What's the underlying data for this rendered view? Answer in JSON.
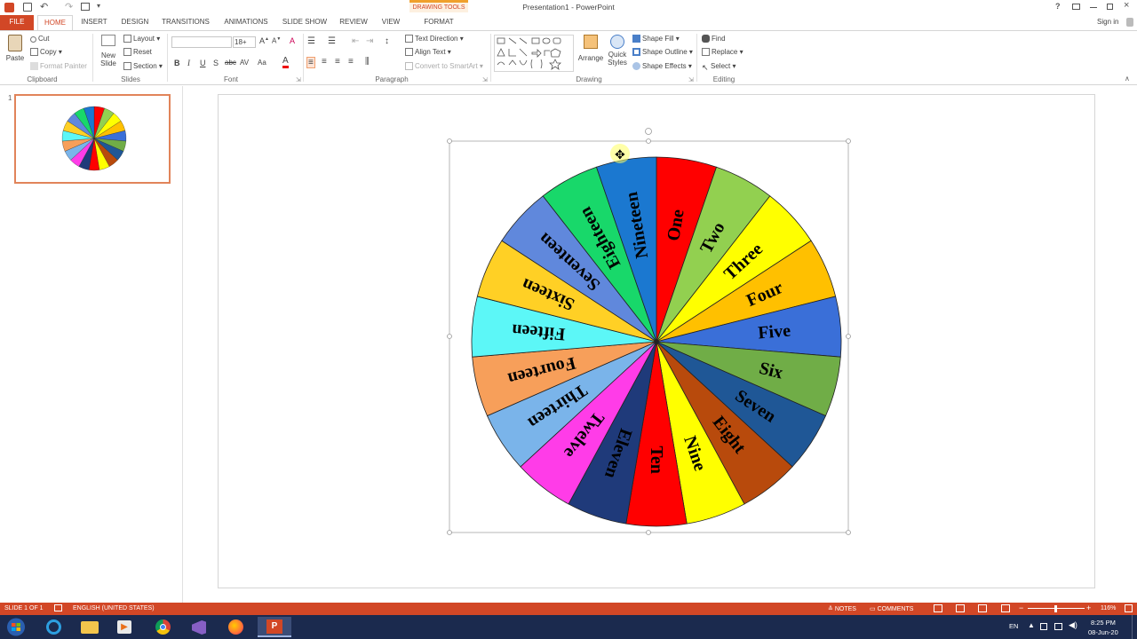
{
  "window": {
    "title": "Presentation1 - PowerPoint",
    "context_tab": "DRAWING TOOLS",
    "sign_in": "Sign in"
  },
  "tabs": [
    "FILE",
    "HOME",
    "INSERT",
    "DESIGN",
    "TRANSITIONS",
    "ANIMATIONS",
    "SLIDE SHOW",
    "REVIEW",
    "VIEW",
    "FORMAT"
  ],
  "ribbon": {
    "clipboard": {
      "label": "Clipboard",
      "paste": "Paste",
      "cut": "Cut",
      "copy": "Copy",
      "format_painter": "Format Painter"
    },
    "slides": {
      "label": "Slides",
      "new_slide_1": "New",
      "new_slide_2": "Slide",
      "layout": "Layout",
      "reset": "Reset",
      "section": "Section"
    },
    "font": {
      "label": "Font",
      "size": "18+",
      "bold": "B",
      "italic": "I",
      "underline": "U",
      "strike": "S",
      "shadow": "abc",
      "spacing": "AV",
      "case": "Aa"
    },
    "paragraph": {
      "label": "Paragraph",
      "text_direction": "Text Direction",
      "align_text": "Align Text",
      "smartart": "Convert to SmartArt"
    },
    "drawing": {
      "label": "Drawing",
      "arrange": "Arrange",
      "quick_styles_1": "Quick",
      "quick_styles_2": "Styles",
      "shape_fill": "Shape Fill",
      "shape_outline": "Shape Outline",
      "shape_effects": "Shape Effects"
    },
    "editing": {
      "label": "Editing",
      "find": "Find",
      "replace": "Replace",
      "select": "Select"
    }
  },
  "thumbnail": {
    "number": "1"
  },
  "wheel": {
    "segments": [
      {
        "label": "One",
        "color": "#ff0000"
      },
      {
        "label": "Two",
        "color": "#92d050"
      },
      {
        "label": "Three",
        "color": "#ffff00"
      },
      {
        "label": "Four",
        "color": "#ffc000"
      },
      {
        "label": "Five",
        "color": "#3a6fd8"
      },
      {
        "label": "Six",
        "color": "#70ad47"
      },
      {
        "label": "Seven",
        "color": "#1f5796"
      },
      {
        "label": "Eight",
        "color": "#b84a0c"
      },
      {
        "label": "Nine",
        "color": "#ffff00"
      },
      {
        "label": "Ten",
        "color": "#ff0000"
      },
      {
        "label": "Eleven",
        "color": "#1f3a7a"
      },
      {
        "label": "Twelve",
        "color": "#ff3ce8"
      },
      {
        "label": "Thirteen",
        "color": "#7ab4ea"
      },
      {
        "label": "Fourteen",
        "color": "#f79f5a"
      },
      {
        "label": "Fifteen",
        "color": "#5cf7f7"
      },
      {
        "label": "Sixteen",
        "color": "#ffd025"
      },
      {
        "label": "Seventeen",
        "color": "#6088dc"
      },
      {
        "label": "Eighteen",
        "color": "#18d86a"
      },
      {
        "label": "Nineteen",
        "color": "#1b78d0"
      }
    ]
  },
  "status": {
    "slide": "SLIDE 1 OF 1",
    "language": "ENGLISH (UNITED STATES)",
    "notes": "NOTES",
    "comments": "COMMENTS",
    "zoom": "116%"
  },
  "taskbar": {
    "lang": "EN",
    "time": "8:25 PM",
    "date": "08-Jun-20"
  },
  "colors": {
    "accent": "#d24726",
    "taskbar": "#1b2a4e"
  }
}
